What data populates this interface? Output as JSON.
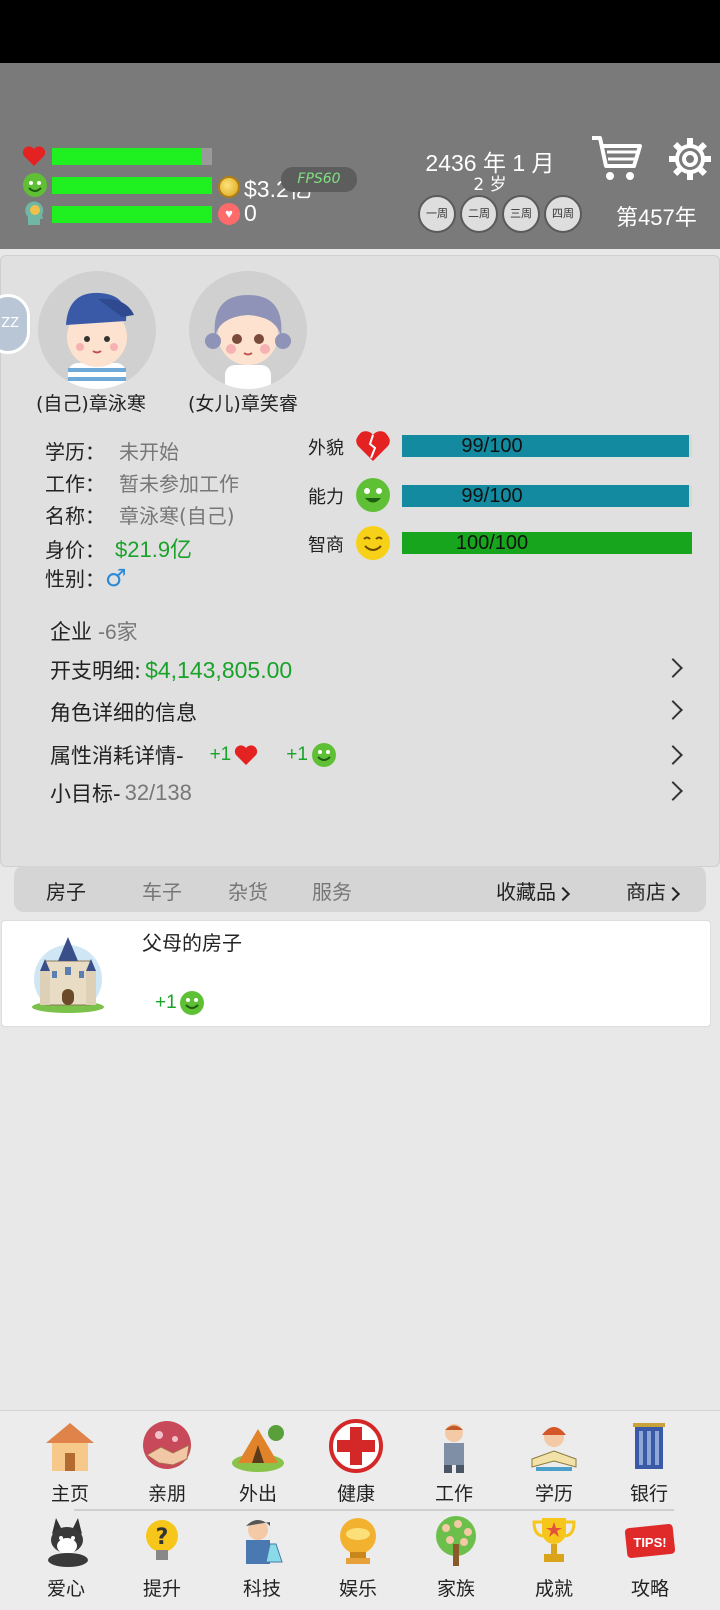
{
  "header": {
    "stats": {
      "health": 0.94,
      "happiness": 1.0,
      "intelligence": 1.0
    },
    "money": "$3.2亿",
    "fps": "FPS60",
    "reputation": "0",
    "date": "2436 年 1 月",
    "age": "2 岁",
    "weeks": [
      "一周",
      "二周",
      "三周",
      "四周"
    ],
    "year_count": "第457年",
    "icons": {
      "cart": "shopping-cart-icon",
      "gear": "gear-icon"
    }
  },
  "profile": {
    "side_tab": "ZZ",
    "avatars": [
      {
        "label": "(自己)章泳寒"
      },
      {
        "label": "(女儿)章笑睿"
      }
    ],
    "info": {
      "education_label": "学历：",
      "education_value": "未开始",
      "job_label": "工作：",
      "job_value": "暂未参加工作",
      "name_label": "名称：",
      "name_value": "章泳寒(自己)",
      "worth_label": "身价：",
      "worth_value": "$21.9亿",
      "gender_label": "性别：",
      "gender_value": "♂"
    },
    "attributes": [
      {
        "label": "外貌",
        "value": "99/100",
        "fraction": 0.99,
        "color": "#138aa0"
      },
      {
        "label": "能力",
        "value": "99/100",
        "fraction": 0.99,
        "color": "#138aa0"
      },
      {
        "label": "智商",
        "value": "100/100",
        "fraction": 1.0,
        "color": "#17a51d"
      }
    ],
    "details": {
      "company_label": "企业",
      "company_value": "-6家",
      "expense_label": "开支明细:",
      "expense_value": "$4,143,805.00",
      "character_info": "角色详细的信息",
      "attr_cost_label": "属性消耗详情-",
      "attr_cost_heart": "+1",
      "attr_cost_face": "+1",
      "goals_label": "小目标-",
      "goals_value": "32/138"
    }
  },
  "tabs": {
    "house": "房子",
    "car": "车子",
    "goods": "杂货",
    "service": "服务",
    "collection": "收藏品",
    "shop": "商店"
  },
  "house_card": {
    "title": "父母的房子",
    "bonus": "+1"
  },
  "bottom_nav": {
    "row1": [
      "主页",
      "亲朋",
      "外出",
      "健康",
      "工作",
      "学历",
      "银行"
    ],
    "row2": [
      "爱心",
      "提升",
      "科技",
      "娱乐",
      "家族",
      "成就",
      "攻略"
    ],
    "tips_text": "TIPS!"
  }
}
